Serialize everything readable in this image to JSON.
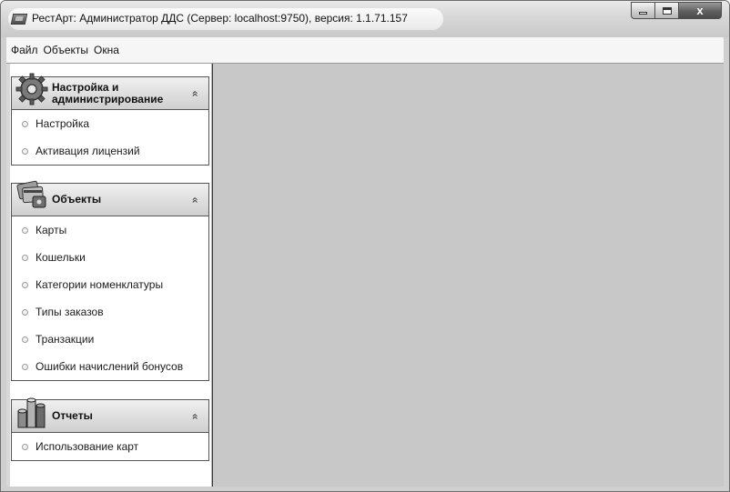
{
  "window": {
    "title": "РестАрт: Администратор ДДС (Сервер: localhost:9750), версия: 1.1.71.157",
    "controls": {
      "minimize": "minimize",
      "maximize": "maximize",
      "close_label": "x"
    }
  },
  "menubar": {
    "items": [
      {
        "label": "Файл"
      },
      {
        "label": "Объекты"
      },
      {
        "label": "Окна"
      }
    ]
  },
  "sidebar": {
    "groups": [
      {
        "title_line1": "Настройка и",
        "title_line2": "администрирование",
        "icon": "gear-icon",
        "items": [
          {
            "label": "Настройка"
          },
          {
            "label": "Активация лицензий"
          }
        ]
      },
      {
        "title_line1": "Объекты",
        "title_line2": "",
        "icon": "cards-icon",
        "items": [
          {
            "label": "Карты"
          },
          {
            "label": "Кошельки"
          },
          {
            "label": "Категории номенклатуры"
          },
          {
            "label": "Типы заказов"
          },
          {
            "label": "Транзакции"
          },
          {
            "label": "Ошибки начислений бонусов"
          }
        ]
      },
      {
        "title_line1": "Отчеты",
        "title_line2": "",
        "icon": "report-chart-icon",
        "items": [
          {
            "label": "Использование карт"
          }
        ]
      }
    ],
    "collapse_glyph": "»"
  }
}
